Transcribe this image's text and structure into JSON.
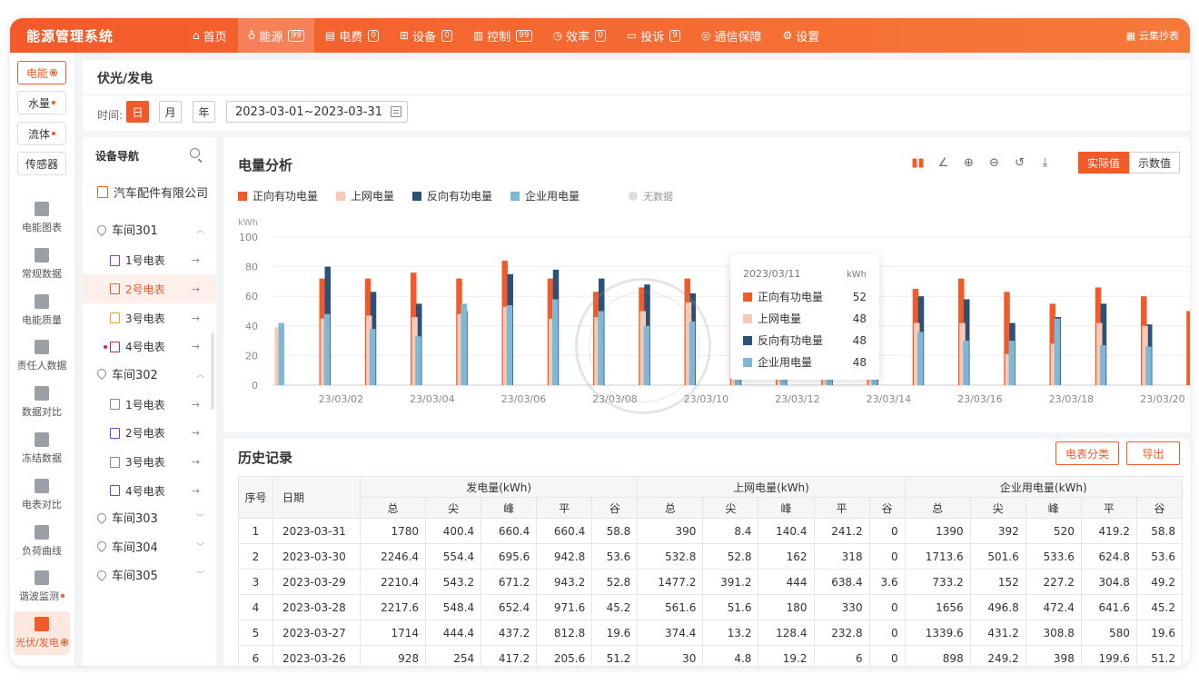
{
  "app": {
    "title": "能源管理系统",
    "top_right": "云集抄表"
  },
  "nav": [
    {
      "label": "首页",
      "icon": "home-icon",
      "glyph": "⌂",
      "badge": ""
    },
    {
      "label": "能源",
      "icon": "bulb-icon",
      "glyph": "♁",
      "badge": "99",
      "active": true
    },
    {
      "label": "电费",
      "icon": "bill-icon",
      "glyph": "▤",
      "badge": "0"
    },
    {
      "label": "设备",
      "icon": "grid-icon",
      "glyph": "⊞",
      "badge": "0"
    },
    {
      "label": "控制",
      "icon": "control-icon",
      "glyph": "▥",
      "badge": "99"
    },
    {
      "label": "效率",
      "icon": "clock-icon",
      "glyph": "◷",
      "badge": "0"
    },
    {
      "label": "投诉",
      "icon": "chat-icon",
      "glyph": "▭",
      "badge": "9"
    },
    {
      "label": "通信保障",
      "icon": "signal-icon",
      "glyph": "◎",
      "badge": ""
    },
    {
      "label": "设置",
      "icon": "gear-icon",
      "glyph": "⚙",
      "badge": ""
    }
  ],
  "left_tags": [
    {
      "label": "电能",
      "active": true
    },
    {
      "label": "水量",
      "active": false
    },
    {
      "label": "流体",
      "active": false
    },
    {
      "label": "传感器",
      "active": false
    }
  ],
  "left_menu": [
    {
      "label": "电能图表",
      "icon": "bar-chart-icon",
      "active": false
    },
    {
      "label": "常规数据",
      "icon": "data-icon",
      "active": false
    },
    {
      "label": "电能质量",
      "icon": "lightning-icon",
      "active": false
    },
    {
      "label": "责任人数据",
      "icon": "person-icon",
      "active": false
    },
    {
      "label": "数据对比",
      "icon": "pie-icon",
      "active": false
    },
    {
      "label": "冻结数据",
      "icon": "document-icon",
      "active": false
    },
    {
      "label": "电表对比",
      "icon": "meter-icon",
      "active": false
    },
    {
      "label": "负荷曲线",
      "icon": "curve-icon",
      "active": false
    },
    {
      "label": "谐波监测",
      "icon": "wave-icon",
      "active": false
    },
    {
      "label": "光伏/发电",
      "icon": "solar-icon",
      "active": true
    }
  ],
  "page": {
    "title": "伏光/发电",
    "time_label": "时间:",
    "day": "日",
    "month": "月",
    "year": "年",
    "date_range": "2023-03-01~2023-03-31"
  },
  "device_nav": {
    "title": "设备导航",
    "company": "汽车配件有限公司",
    "workshops": [
      {
        "name": "车间301",
        "expanded": true,
        "meters": [
          "1号电表",
          "2号电表",
          "3号电表",
          "4号电表"
        ]
      },
      {
        "name": "车间302",
        "expanded": true,
        "meters": [
          "1号电表",
          "2号电表",
          "3号电表",
          "4号电表"
        ]
      },
      {
        "name": "车间303",
        "expanded": false
      },
      {
        "name": "车间304",
        "expanded": false
      },
      {
        "name": "车间305",
        "expanded": false
      }
    ]
  },
  "chart_panel": {
    "title": "电量分析",
    "btn_actual": "实际值",
    "btn_reading": "示数值",
    "no_data": "无数据"
  },
  "colors": {
    "forward": "#f25a29",
    "grid_up": "#f9c9b8",
    "reverse": "#2b5179",
    "enterprise": "#7fb7d6",
    "accent": "#f25a29"
  },
  "chart_data": {
    "type": "bar",
    "ylabel": "kWh",
    "ylim": [
      0,
      100
    ],
    "yticks": [
      0,
      20,
      40,
      60,
      80,
      100
    ],
    "categories": [
      "23/03/01",
      "23/03/02",
      "23/03/03",
      "23/03/04",
      "23/03/05",
      "23/03/06",
      "23/03/07",
      "23/03/08",
      "23/03/09",
      "23/03/10",
      "23/03/11",
      "23/03/12",
      "23/03/13",
      "23/03/14",
      "23/03/15",
      "23/03/16",
      "23/03/17",
      "23/03/18",
      "23/03/19",
      "23/03/20"
    ],
    "xtick_labels": [
      "23/03/02",
      "23/03/04",
      "23/03/06",
      "23/03/08",
      "23/03/10",
      "23/03/12",
      "23/03/14",
      "23/03/16",
      "23/03/18",
      "23/03/20"
    ],
    "series": [
      {
        "name": "正向有功电量",
        "values": [
          72,
          72,
          76,
          72,
          84,
          72,
          63,
          66,
          72,
          70,
          52,
          50,
          70,
          65,
          72,
          63,
          55,
          66,
          60,
          50
        ]
      },
      {
        "name": "上网电量",
        "values": [
          39,
          45,
          47,
          46,
          48,
          53,
          45,
          46,
          50,
          56,
          48,
          40,
          56,
          52,
          42,
          42,
          21,
          28,
          42,
          40
        ]
      },
      {
        "name": "反向有功电量",
        "values": [
          80,
          63,
          55,
          50,
          75,
          78,
          72,
          68,
          62,
          68,
          48,
          58,
          68,
          60,
          58,
          42,
          46,
          55,
          41,
          31
        ]
      },
      {
        "name": "企业用电量",
        "values": [
          42,
          48,
          38,
          33,
          55,
          54,
          58,
          50,
          40,
          43,
          48,
          38,
          50,
          38,
          36,
          30,
          30,
          45,
          27,
          26
        ]
      }
    ],
    "tooltip": {
      "date": "2023/03/11",
      "unit": "kWh",
      "rows": [
        {
          "name": "正向有功电量",
          "value": "52"
        },
        {
          "name": "上网电量",
          "value": "48"
        },
        {
          "name": "反向有功电量",
          "value": "48"
        },
        {
          "name": "企业用电量",
          "value": "48"
        }
      ]
    }
  },
  "history": {
    "title": "历史记录",
    "btn_category": "电表分类",
    "btn_export": "导出",
    "col_index": "序号",
    "col_date": "日期",
    "groups": [
      "发电量(kWh)",
      "上网电量(kWh)",
      "企业用电量(kWh)"
    ],
    "subcols": [
      "总",
      "尖",
      "峰",
      "平",
      "谷"
    ],
    "rows": [
      [
        "1",
        "2023-03-31",
        "1780",
        "400.4",
        "660.4",
        "660.4",
        "58.8",
        "390",
        "8.4",
        "140.4",
        "241.2",
        "0",
        "1390",
        "392",
        "520",
        "419.2",
        "58.8"
      ],
      [
        "2",
        "2023-03-30",
        "2246.4",
        "554.4",
        "695.6",
        "942.8",
        "53.6",
        "532.8",
        "52.8",
        "162",
        "318",
        "0",
        "1713.6",
        "501.6",
        "533.6",
        "624.8",
        "53.6"
      ],
      [
        "3",
        "2023-03-29",
        "2210.4",
        "543.2",
        "671.2",
        "943.2",
        "52.8",
        "1477.2",
        "391.2",
        "444",
        "638.4",
        "3.6",
        "733.2",
        "152",
        "227.2",
        "304.8",
        "49.2"
      ],
      [
        "4",
        "2023-03-28",
        "2217.6",
        "548.4",
        "652.4",
        "971.6",
        "45.2",
        "561.6",
        "51.6",
        "180",
        "330",
        "0",
        "1656",
        "496.8",
        "472.4",
        "641.6",
        "45.2"
      ],
      [
        "5",
        "2023-03-27",
        "1714",
        "444.4",
        "437.2",
        "812.8",
        "19.6",
        "374.4",
        "13.2",
        "128.4",
        "232.8",
        "0",
        "1339.6",
        "431.2",
        "308.8",
        "580",
        "19.6"
      ],
      [
        "6",
        "2023-03-26",
        "928",
        "254",
        "417.2",
        "205.6",
        "51.2",
        "30",
        "4.8",
        "19.2",
        "6",
        "0",
        "898",
        "249.2",
        "398",
        "199.6",
        "51.2"
      ]
    ]
  }
}
